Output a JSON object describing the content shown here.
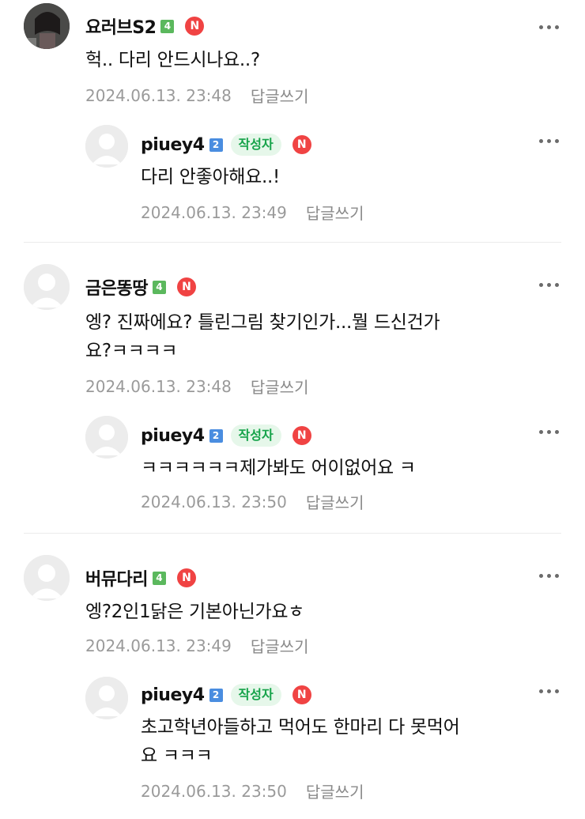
{
  "badges": {
    "author": "작성자",
    "new": "N",
    "reply_link": "답글쓰기"
  },
  "comments": [
    {
      "nick": "요러브S2",
      "level": "4",
      "text": "헉.. 다리 안드시나요..?",
      "date": "2024.06.13. 23:48",
      "reply": {
        "nick": "piuey4",
        "level": "2",
        "text": "다리 안좋아해요..!",
        "date": "2024.06.13. 23:49"
      }
    },
    {
      "nick": "금은똥땅",
      "level": "4",
      "text": "엥? 진짜에요? 틀린그림 찾기인가...뭘 드신건가\n요?ㅋㅋㅋㅋ",
      "date": "2024.06.13. 23:48",
      "reply": {
        "nick": "piuey4",
        "level": "2",
        "text": "ㅋㅋㅋㅋㅋㅋ제가봐도 어이없어요 ㅋ",
        "date": "2024.06.13. 23:50"
      }
    },
    {
      "nick": "버뮤다리",
      "level": "4",
      "text": "엥?2인1닭은 기본아닌가요ㅎ",
      "date": "2024.06.13. 23:49",
      "reply": {
        "nick": "piuey4",
        "level": "2",
        "text": "초고학년아들하고 먹어도 한마리 다 못먹어\n요 ㅋㅋㅋ",
        "date": "2024.06.13. 23:50"
      }
    }
  ]
}
